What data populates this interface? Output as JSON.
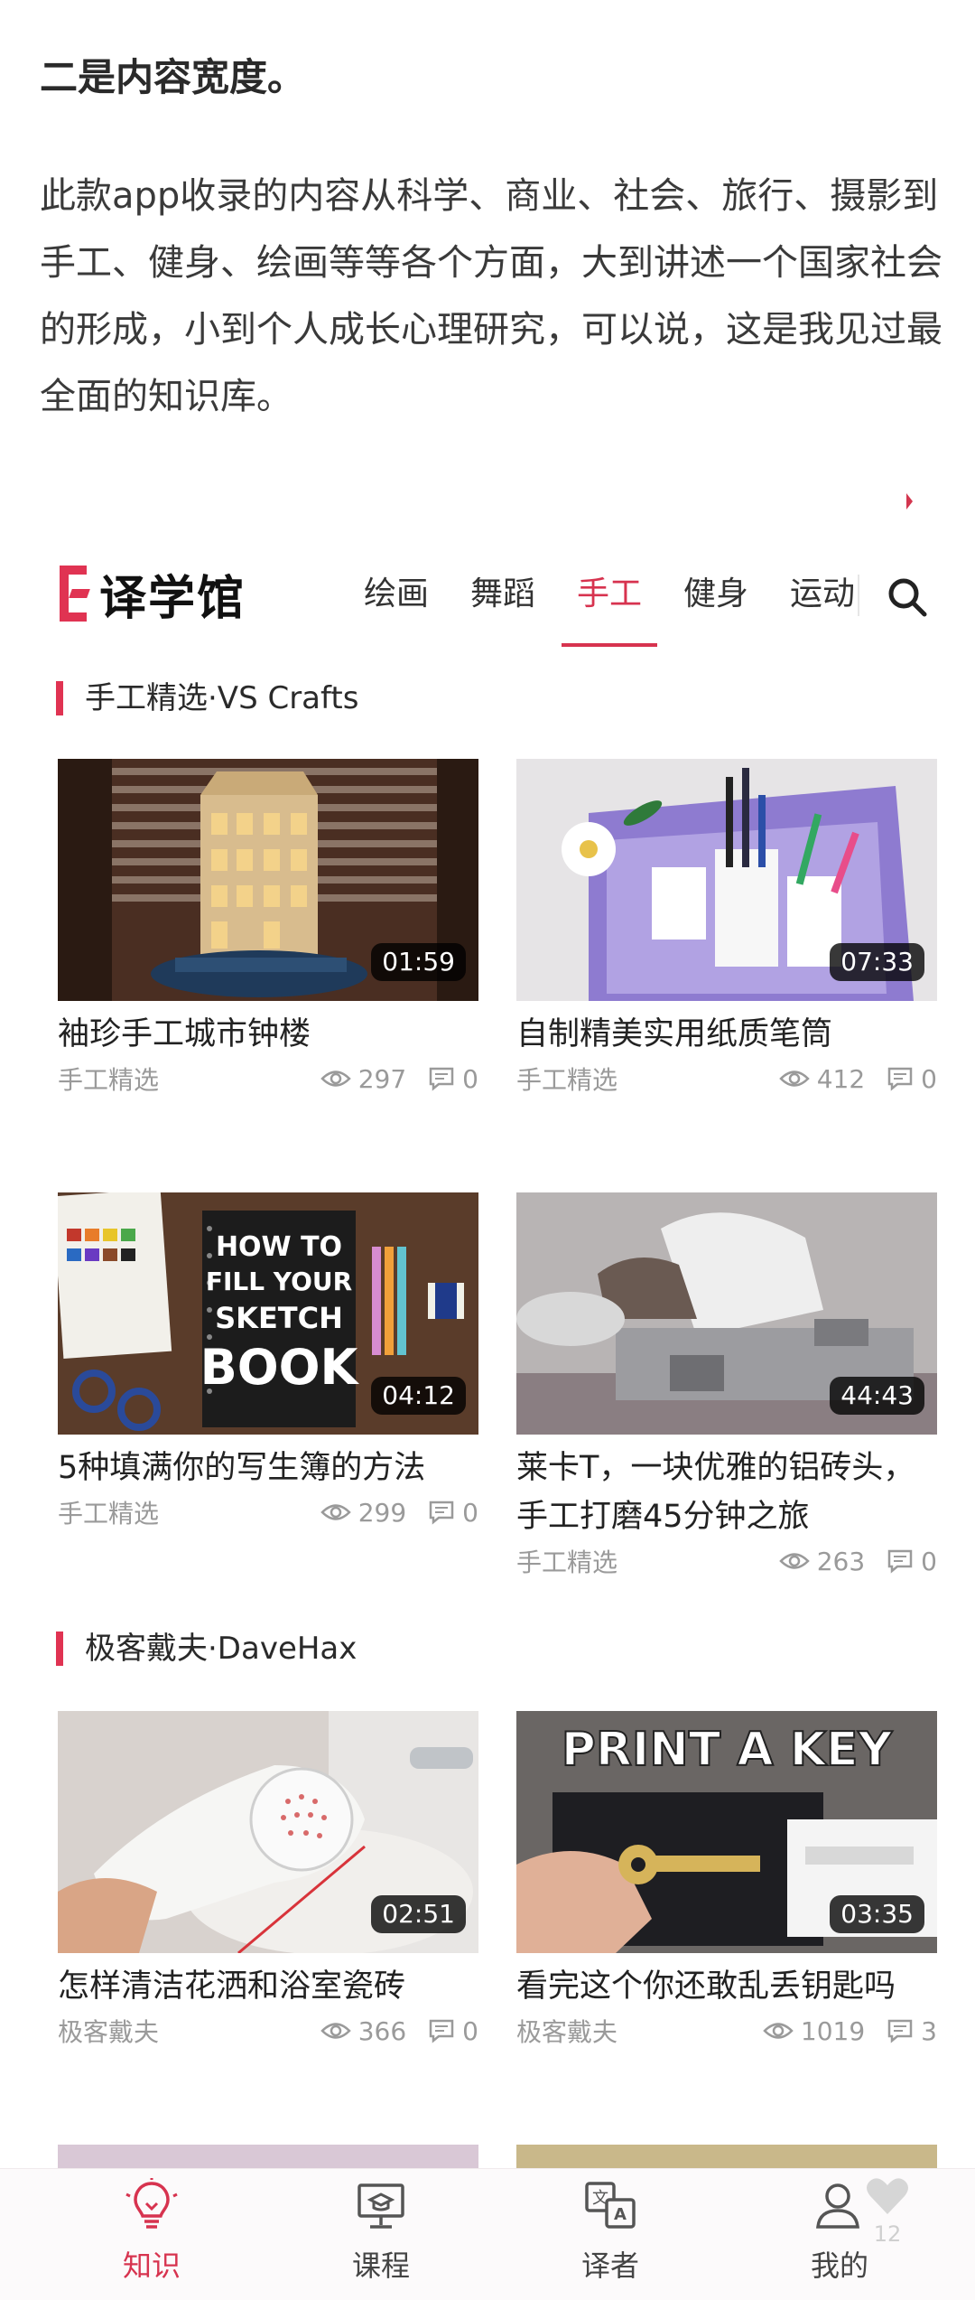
{
  "article": {
    "heading": "二是内容宽度。",
    "paragraph": "此款app收录的内容从科学、商业、社会、旅行、摄影到手工、健身、绘画等等各个方面，大到讲述一个国家社会的形成，小到个人成长心理研究，可以说，这是我见过最全面的知识库。"
  },
  "app": {
    "logo_text": "译学馆",
    "tabs": [
      "绘画",
      "舞蹈",
      "手工",
      "健身",
      "运动"
    ],
    "active_tab": "手工",
    "accent_color": "#d7334f",
    "sections": [
      {
        "title": "手工精选·VS Crafts",
        "cards": [
          {
            "title": "袖珍手工城市钟楼",
            "duration": "01:59",
            "source": "手工精选",
            "views": "297",
            "comments": "0"
          },
          {
            "title": "自制精美实用纸质笔筒",
            "duration": "07:33",
            "source": "手工精选",
            "views": "412",
            "comments": "0"
          },
          {
            "title": "5种填满你的写生簿的方法",
            "duration": "04:12",
            "source": "手工精选",
            "views": "299",
            "comments": "0",
            "thumb_text": [
              "HOW TO",
              "FILL YOUR",
              "SKETCH",
              "BOOK"
            ]
          },
          {
            "title": "莱卡T，一块优雅的铝砖头，手工打磨45分钟之旅",
            "duration": "44:43",
            "source": "手工精选",
            "views": "263",
            "comments": "0"
          }
        ]
      },
      {
        "title": "极客戴夫·DaveHax",
        "cards": [
          {
            "title": "怎样清洁花洒和浴室瓷砖",
            "duration": "02:51",
            "source": "极客戴夫",
            "views": "366",
            "comments": "0"
          },
          {
            "title": "看完这个你还敢乱丢钥匙吗",
            "duration": "03:35",
            "source": "极客戴夫",
            "views": "1019",
            "comments": "3",
            "thumb_text": [
              "PRINT A KEY"
            ]
          }
        ]
      }
    ],
    "bottom_nav": [
      {
        "label": "知识",
        "icon": "bulb-icon",
        "active": true
      },
      {
        "label": "课程",
        "icon": "course-icon",
        "active": false
      },
      {
        "label": "译者",
        "icon": "translator-icon",
        "active": false
      },
      {
        "label": "我的",
        "icon": "user-icon",
        "active": false
      }
    ],
    "heart_count": "12"
  }
}
